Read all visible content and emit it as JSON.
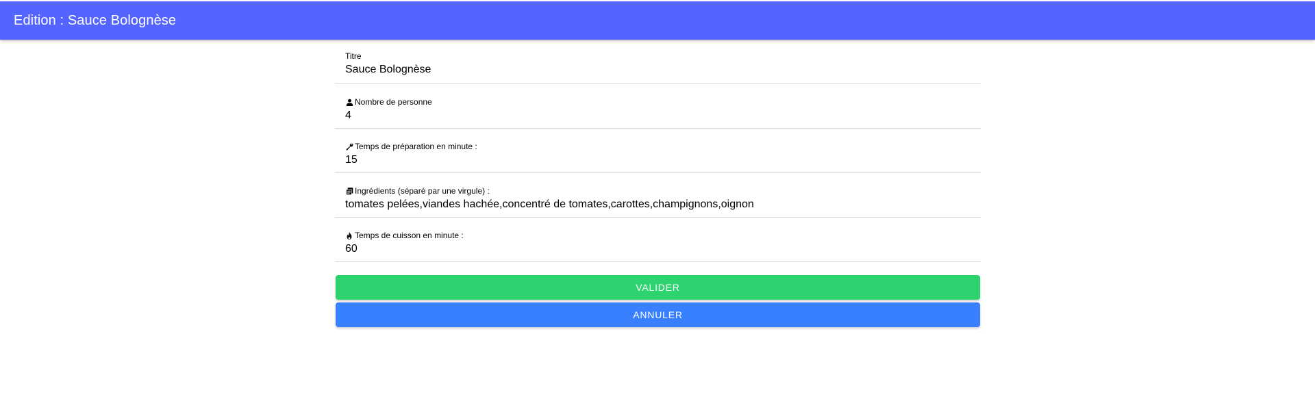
{
  "header": {
    "title": "Edition : Sauce Bolognèse",
    "color": "#5464ff"
  },
  "form": {
    "fields": [
      {
        "label": "Titre",
        "icon": "",
        "value": "Sauce Bolognèse"
      },
      {
        "label": "Nombre de personne",
        "icon": "person-icon",
        "value": "4"
      },
      {
        "label": "Temps de préparation en minute :",
        "icon": "wrench-icon",
        "value": "15"
      },
      {
        "label": "Ingrédients (séparé par une virgule) :",
        "icon": "receipt-icon",
        "value": "tomates pelées,viandes hachée,concentré de tomates,carottes,champignons,oignon"
      },
      {
        "label": "Temps de cuisson en minute :",
        "icon": "flame-icon",
        "value": "60"
      }
    ]
  },
  "actions": {
    "validate_label": "Valider",
    "validate_color": "#2dd36f",
    "cancel_label": "Annuler",
    "cancel_color": "#3880ff"
  }
}
